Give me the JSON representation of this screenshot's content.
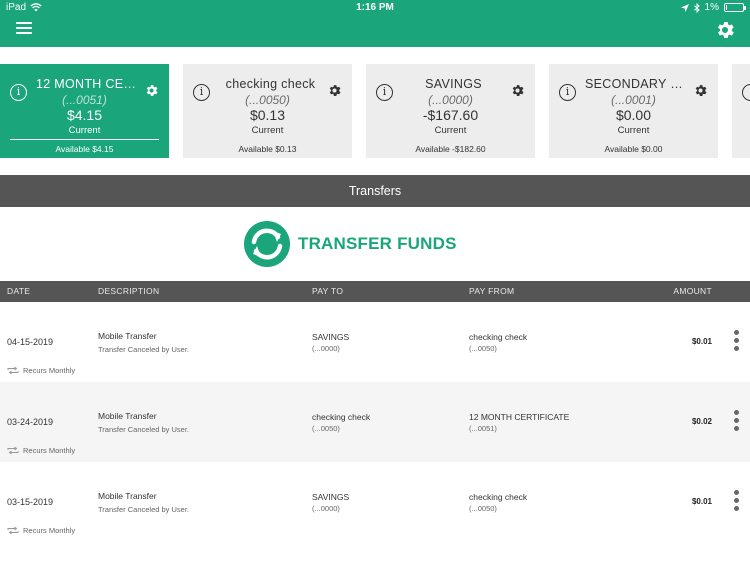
{
  "status": {
    "device": "iPad",
    "time": "1:16 PM",
    "battery": "1%",
    "battery_level": 0.01
  },
  "header": {
    "menu_icon": "hamburger-icon",
    "settings_icon": "gear-icon"
  },
  "accounts": [
    {
      "name": "12 MONTH CERTI…",
      "number": "(...0051)",
      "balance": "$4.15",
      "balance_label": "Current",
      "available": "Available $4.15",
      "active": true
    },
    {
      "name": "checking check",
      "number": "(...0050)",
      "balance": "$0.13",
      "balance_label": "Current",
      "available": "Available $0.13",
      "active": false
    },
    {
      "name": "SAVINGS",
      "number": "(...0000)",
      "balance": "-$167.60",
      "balance_label": "Current",
      "available": "Available -$182.60",
      "active": false
    },
    {
      "name": "SECONDARY SHARE",
      "number": "(...0001)",
      "balance": "$0.00",
      "balance_label": "Current",
      "available": "Available $0.00",
      "active": false
    }
  ],
  "section": {
    "title": "Transfers"
  },
  "transfer_button": {
    "label": "TRANSFER FUNDS",
    "icon": "refresh-arrows-icon"
  },
  "table": {
    "columns": [
      "DATE",
      "DESCRIPTION",
      "PAY TO",
      "PAY FROM",
      "AMOUNT"
    ],
    "rows": [
      {
        "date": "04-15-2019",
        "description": "Mobile Transfer",
        "status": "Transfer Canceled by User.",
        "pay_to": "SAVINGS",
        "pay_to_acct": "(...0000)",
        "pay_from": "checking check",
        "pay_from_acct": "(...0050)",
        "amount": "$0.01",
        "recurrence": "Recurs Monthly"
      },
      {
        "date": "03-24-2019",
        "description": "Mobile Transfer",
        "status": "Transfer Canceled by User.",
        "pay_to": "checking check",
        "pay_to_acct": "(...0050)",
        "pay_from": "12 MONTH CERTIFICATE",
        "pay_from_acct": "(...0051)",
        "amount": "$0.02",
        "recurrence": "Recurs Monthly"
      },
      {
        "date": "03-15-2019",
        "description": "Mobile Transfer",
        "status": "Transfer Canceled by User.",
        "pay_to": "SAVINGS",
        "pay_to_acct": "(...0000)",
        "pay_from": "checking check",
        "pay_from_acct": "(...0050)",
        "amount": "$0.01",
        "recurrence": "Recurs Monthly"
      }
    ]
  },
  "colors": {
    "brand": "#1aa57a",
    "header_bar": "#555555",
    "card_bg": "#ededed"
  }
}
